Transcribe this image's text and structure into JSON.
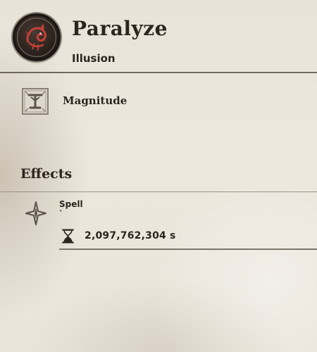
{
  "spell": {
    "icon": "red-dragon-icon",
    "name": "Paralyze",
    "school": "Illusion"
  },
  "property": {
    "icon": "magnitude-icon",
    "label": "Magnitude"
  },
  "effects": {
    "heading": "Effects",
    "items": [
      {
        "icon": "diamond-star-icon",
        "label": "Spell",
        "sub": "`",
        "duration_icon": "hourglass-icon",
        "duration": "2,097,762,304 s"
      }
    ]
  },
  "colors": {
    "parchment": "#ebe6dc",
    "ink": "#2c241e",
    "accent_red": "#c9413a",
    "divider": "#6f665c"
  }
}
